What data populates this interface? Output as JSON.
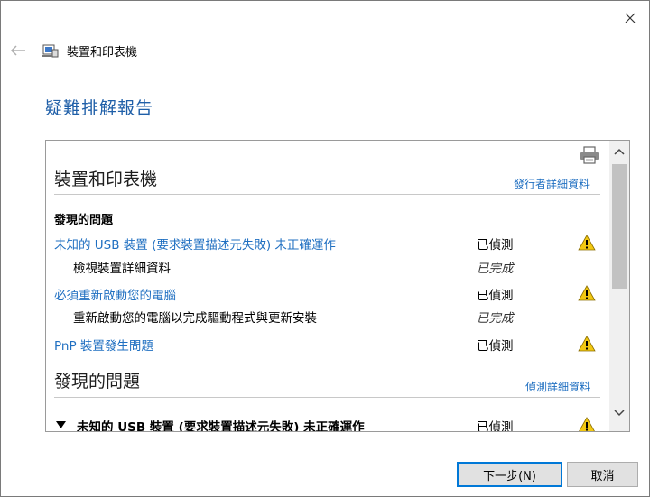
{
  "window": {
    "title": "裝置和印表機",
    "heading": "疑難排解報告"
  },
  "report": {
    "section1": {
      "title": "裝置和印表機",
      "publisher_link": "發行者詳細資料",
      "subheading": "發現的問題",
      "items": [
        {
          "label": "未知的 USB 裝置 (要求裝置描述元失敗) 未正確運作",
          "status": "已偵測"
        },
        {
          "label": "檢視裝置詳細資料",
          "status": "已完成"
        },
        {
          "label": "必須重新啟動您的電腦",
          "status": "已偵測"
        },
        {
          "label": "重新啟動您的電腦以完成驅動程式與更新安裝",
          "status": "已完成"
        },
        {
          "label": "PnP 裝置發生問題",
          "status": "已偵測"
        }
      ]
    },
    "section2": {
      "title": "發現的問題",
      "details_link": "偵測詳細資料",
      "item": {
        "label": "未知的 USB 裝置 (要求裝置描述元失敗) 未正確運作",
        "status": "已偵測"
      }
    }
  },
  "buttons": {
    "next": "下一步(N)",
    "cancel": "取消"
  },
  "colors": {
    "link": "#1f6fc1",
    "heading": "#1f5fa8",
    "warning": "#f2c811"
  },
  "icons": [
    "close-icon",
    "back-arrow-icon",
    "devices-printers-icon",
    "printer-icon",
    "warning-icon",
    "chevron-up-icon",
    "chevron-down-icon",
    "triangle-collapse-icon"
  ]
}
